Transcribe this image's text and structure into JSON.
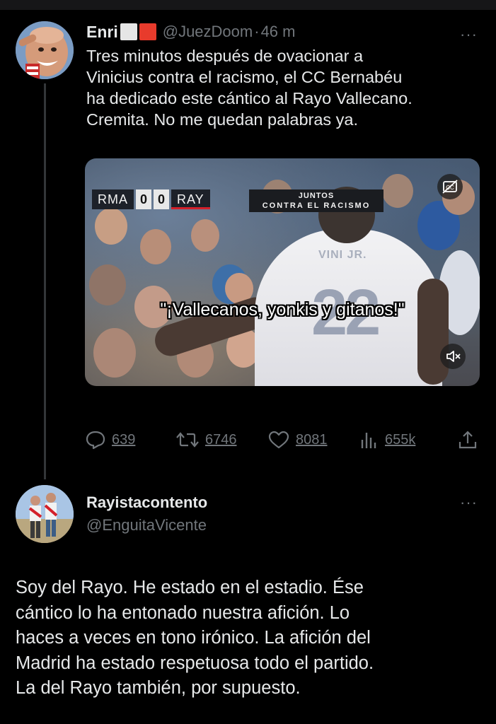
{
  "tweet1": {
    "author_name": "Enri",
    "handle": "@JuezDoom",
    "separator": "·",
    "time": "46 m",
    "more": "···",
    "text": "Tres minutos después de ovacionar a\nVinicius contra el racismo, el CC Bernabéu\nha dedicado este cántico al Rayo Vallecano.\nCremita. No me quedan palabras ya.",
    "video": {
      "home_team": "RMA",
      "home_score": "0",
      "away_score": "0",
      "away_team": "RAY",
      "banner_line1": "JUNTOS",
      "banner_line2": "CONTRA EL RACISMO",
      "caption": "\"¡Vallecanos, yonkis y gitanos!\"",
      "player_number": "22",
      "player_name": "VINI JR."
    },
    "actions": {
      "replies": "639",
      "reposts": "6746",
      "likes": "8081",
      "views": "655k"
    },
    "icons": {
      "reply": "reply-icon",
      "repost": "repost-icon",
      "like": "heart-icon",
      "views": "views-icon",
      "share": "share-icon",
      "captions": "captions-icon",
      "mute": "mute-icon"
    }
  },
  "tweet2": {
    "author_name": "Rayistacontento",
    "handle": "@EnguitaVicente",
    "more": "···",
    "text": "Soy del Rayo. He estado en el estadio. Ése\ncántico lo ha entonado nuestra afición. Lo\nhaces a veces en tono irónico. La afición del\nMadrid ha estado respetuosa todo el partido.\nLa del Rayo también, por supuesto."
  },
  "colors": {
    "background": "#000000",
    "text": "#e7e9ea",
    "muted": "#71767b",
    "thread_line": "#333639",
    "rayo_red": "#d3202a"
  }
}
